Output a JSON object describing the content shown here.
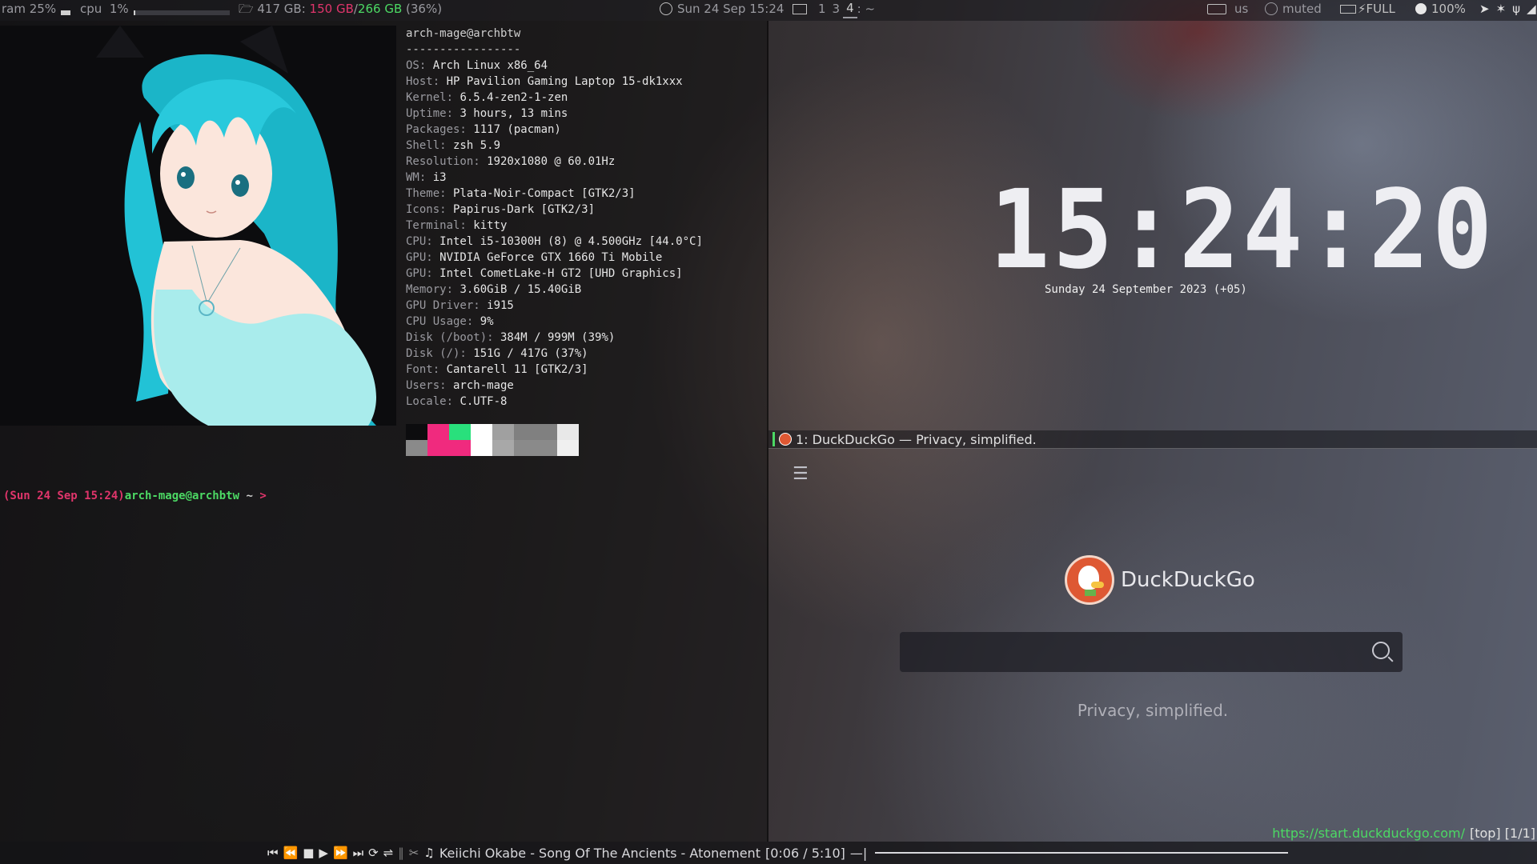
{
  "topbar": {
    "ram_label": "ram",
    "ram_value": "25%",
    "ram_fraction": 0.25,
    "cpu_label": "cpu",
    "cpu_value": "1%",
    "cpu_fraction": 0.01,
    "disk_total": "417 GB:",
    "disk_used": "150 GB",
    "disk_sep": "/",
    "disk_size": "266 GB",
    "disk_percent": "(36%)",
    "datetime": "Sun 24 Sep 15:24",
    "workspaces": [
      "1",
      "3",
      "4"
    ],
    "active_workspace": "4",
    "ws_suffix": ":  ~",
    "keyboard_layout": "us",
    "volume": "muted",
    "battery": "FULL",
    "brightness": "100%"
  },
  "neofetch": {
    "title": "arch-mage@archbtw",
    "separator": "-----------------",
    "rows": [
      {
        "key": "OS:",
        "value": " Arch Linux x86_64"
      },
      {
        "key": "Host:",
        "value": " HP Pavilion Gaming Laptop 15-dk1xxx"
      },
      {
        "key": "Kernel:",
        "value": " 6.5.4-zen2-1-zen"
      },
      {
        "key": "Uptime:",
        "value": " 3 hours, 13 mins"
      },
      {
        "key": "Packages:",
        "value": " 1117 (pacman)"
      },
      {
        "key": "Shell:",
        "value": " zsh 5.9"
      },
      {
        "key": "Resolution:",
        "value": " 1920x1080 @ 60.01Hz"
      },
      {
        "key": "WM:",
        "value": " i3"
      },
      {
        "key": "Theme:",
        "value": " Plata-Noir-Compact [GTK2/3]"
      },
      {
        "key": "Icons:",
        "value": " Papirus-Dark [GTK2/3]"
      },
      {
        "key": "Terminal:",
        "value": " kitty"
      },
      {
        "key": "CPU:",
        "value": " Intel i5-10300H (8) @ 4.500GHz [44.0°C]"
      },
      {
        "key": "GPU:",
        "value": " NVIDIA GeForce GTX 1660 Ti Mobile"
      },
      {
        "key": "GPU:",
        "value": " Intel CometLake-H GT2 [UHD Graphics]"
      },
      {
        "key": "Memory:",
        "value": " 3.60GiB / 15.40GiB"
      },
      {
        "key": "GPU Driver:",
        "value": " i915"
      },
      {
        "key": "CPU Usage:",
        "value": " 9%"
      },
      {
        "key": "Disk (/boot):",
        "value": " 384M / 999M (39%)"
      },
      {
        "key": "Disk (/):",
        "value": " 151G / 417G (37%)"
      },
      {
        "key": "Font:",
        "value": " Cantarell 11 [GTK2/3]"
      },
      {
        "key": "Users:",
        "value": " arch-mage"
      },
      {
        "key": "Locale:",
        "value": " C.UTF-8"
      }
    ],
    "palette_top": [
      "#0c0c0e",
      "#f02a7e",
      "#29e07c",
      "#ffffff",
      "#a0a0a0",
      "#808080",
      "#808080",
      "#e8e8e8"
    ],
    "palette_bottom": [
      "#8a8a8a",
      "#f02a7e",
      "#f02a7e",
      "#ffffff",
      "#a8a8a8",
      "#8a8a8a",
      "#8a8a8a",
      "#f0f0f0"
    ]
  },
  "prompt": {
    "date": "(Sun 24 Sep 15:24)",
    "user": "arch-mage@archbtw",
    "rest": " ~ ",
    "arrow": ">"
  },
  "clock": {
    "time": "15:24:20",
    "date": "Sunday 24 September 2023 (+05)"
  },
  "browser": {
    "tab_title": "1: DuckDuckGo — Privacy, simplified.",
    "brand_name": "DuckDuckGo",
    "tagline": "Privacy, simplified.",
    "search_value": "",
    "status_url": "https://start.duckduckgo.com/",
    "status_scroll": "[top]",
    "status_tabs": "[1/1]"
  },
  "player": {
    "track": "Keiichi Okabe - Song Of The Ancients - Atonement",
    "time": "[0:06 / 5:10]",
    "suffix": "—|"
  },
  "colors": {
    "accent_red": "#e0356b",
    "accent_green": "#4cd964",
    "ddg_orange": "#de5833"
  }
}
